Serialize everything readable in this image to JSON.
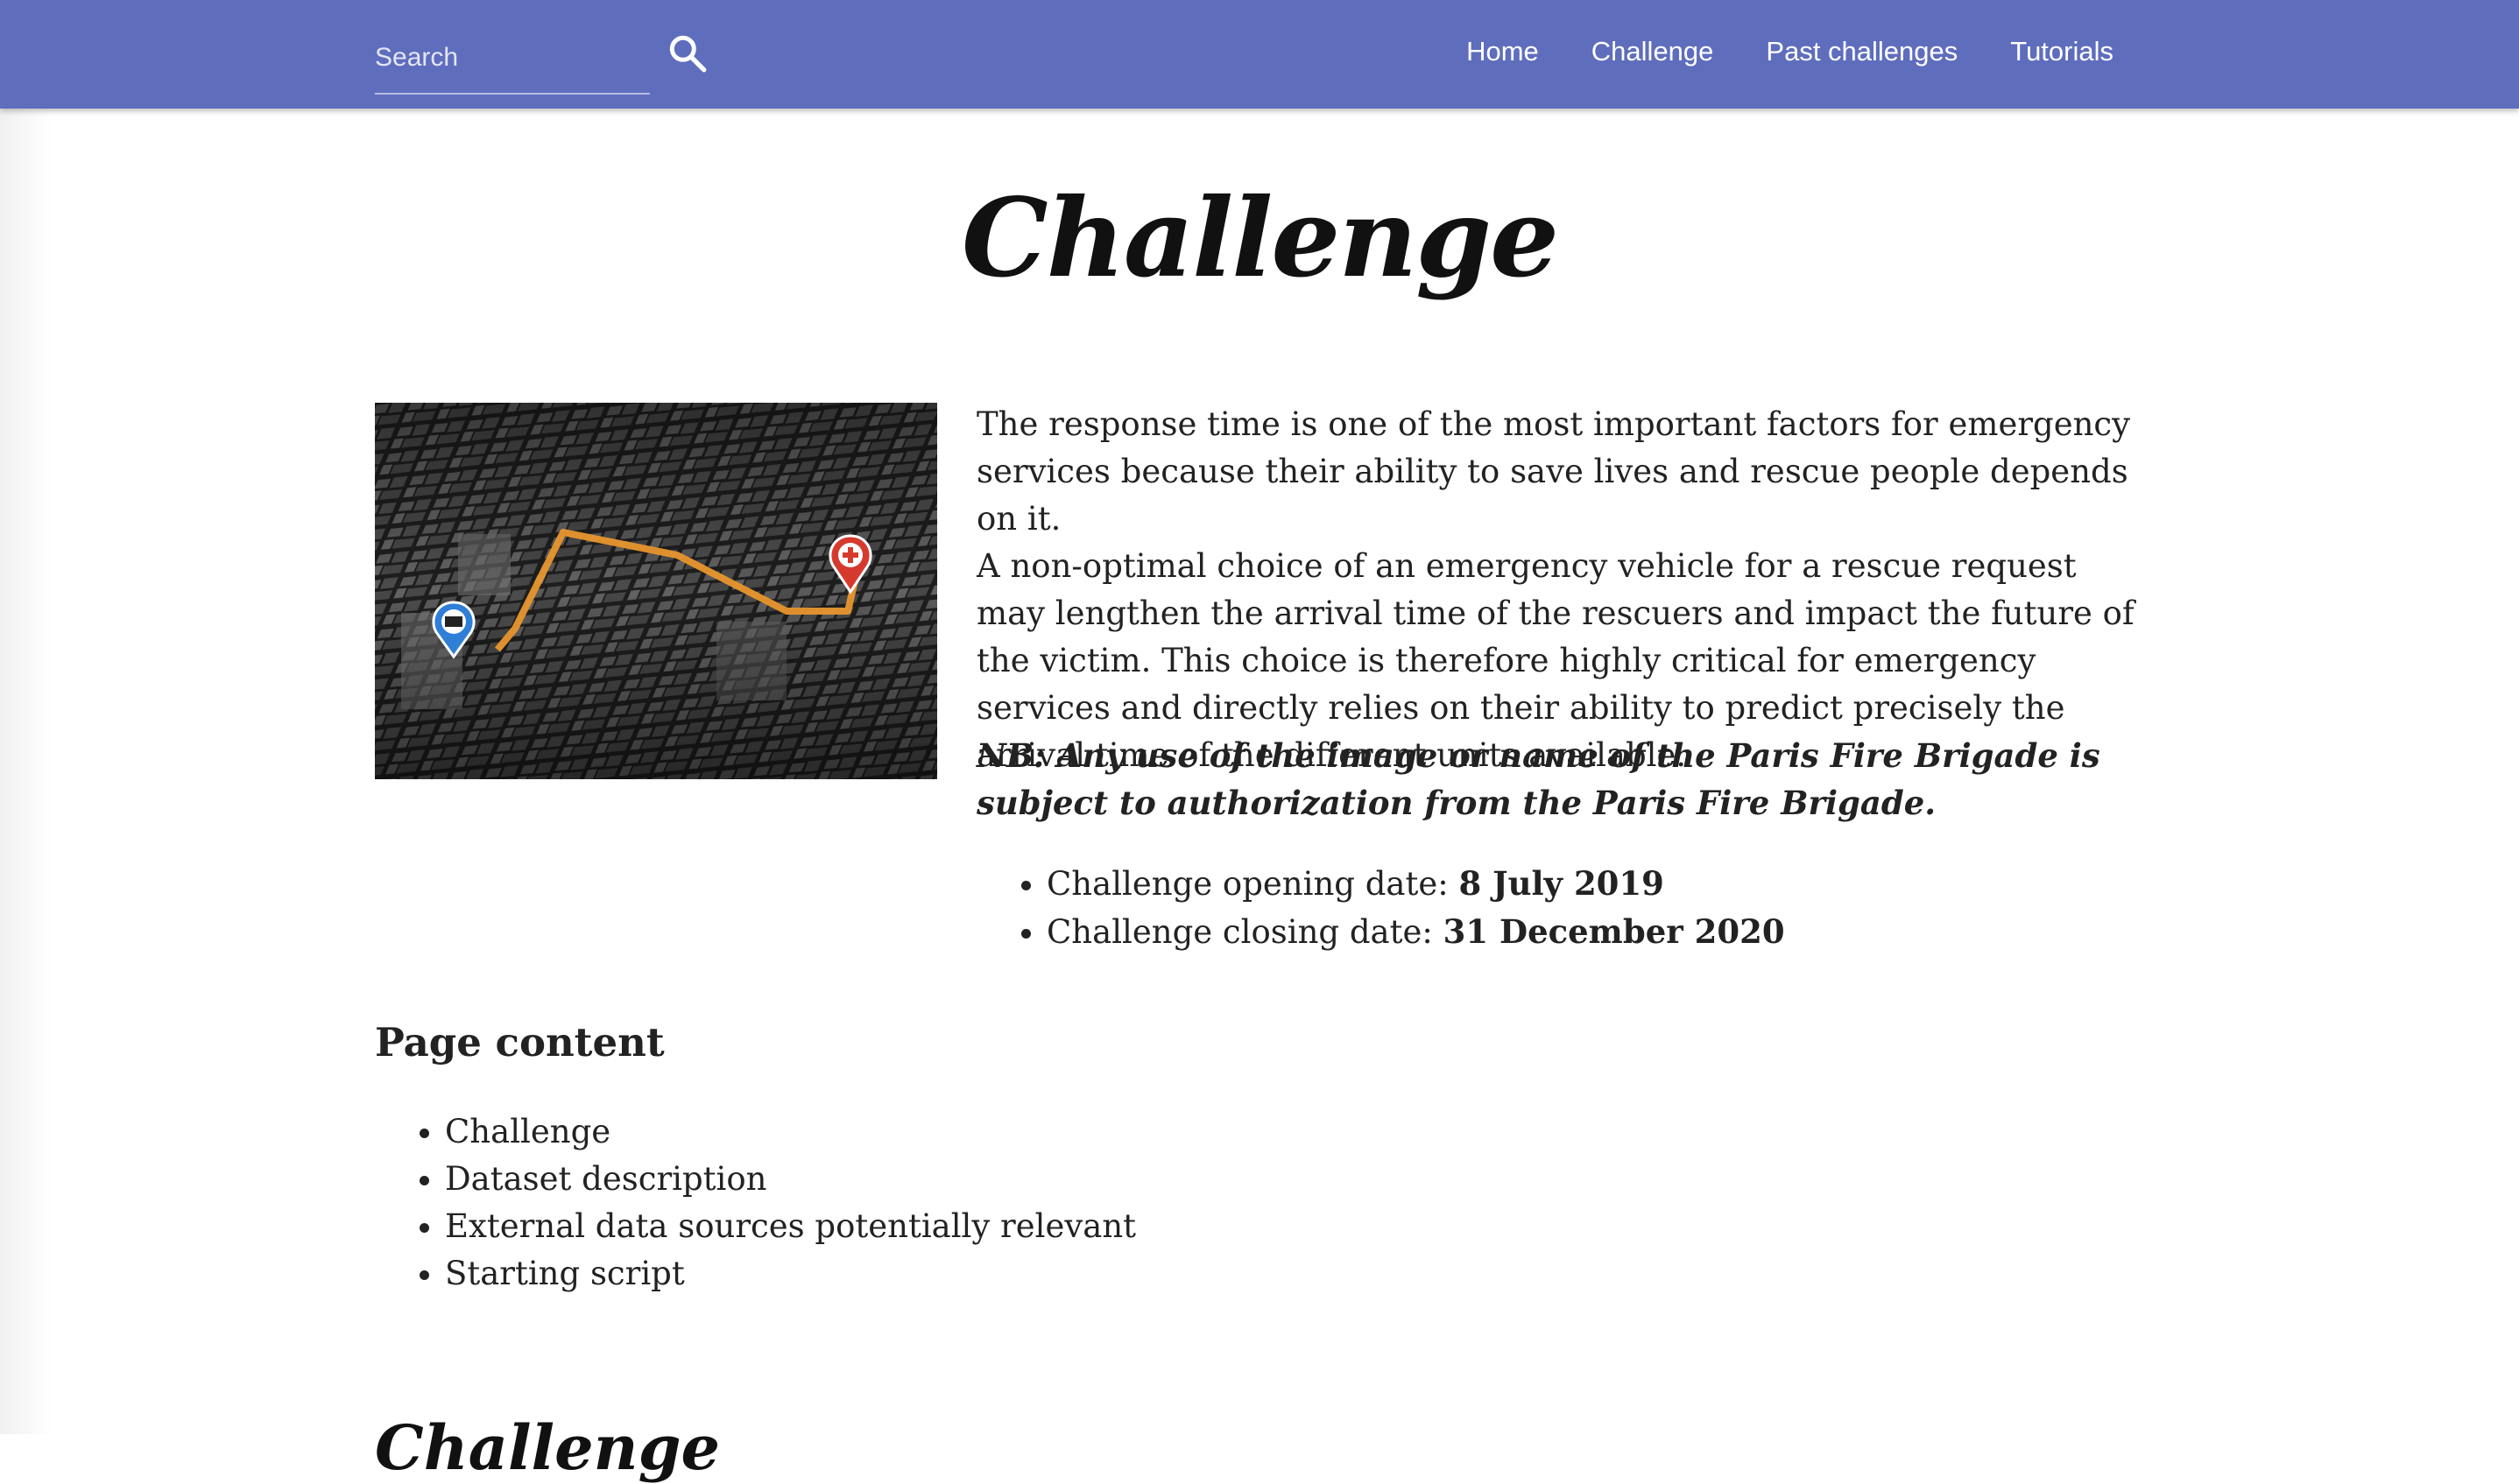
{
  "navbar": {
    "search": {
      "placeholder": "Search",
      "value": ""
    },
    "links": [
      "Home",
      "Challenge",
      "Past challenges",
      "Tutorials"
    ]
  },
  "page": {
    "title": "Challenge"
  },
  "intro": {
    "paragraph1": "The response time is one of the most important factors for emergency services because their ability to save lives and rescue people depends on it.",
    "paragraph2": "A non-optimal choice of an emergency vehicle for a rescue request may lengthen the arrival time of the rescuers and impact the future of the victim. This choice is therefore highly critical for emergency services and directly relies on their ability to predict precisely the arrival time of the different units available.",
    "nb": "NB: Any use of the image or name of the Paris Fire Brigade is subject to authorization from the Paris Fire Brigade."
  },
  "dates": [
    {
      "label": "Challenge opening date: ",
      "value": "8 July 2019"
    },
    {
      "label": "Challenge closing date: ",
      "value": "31 December 2020"
    }
  ],
  "page_content": {
    "heading": "Page content",
    "items": [
      "Challenge",
      "Dataset description",
      "External data sources potentially relevant",
      "Starting script"
    ]
  },
  "next_section": {
    "title": "Challenge"
  },
  "colors": {
    "navbar": "#5f6dbd",
    "route": "#e8962e",
    "start_pin": "#2f7fd6",
    "end_pin": "#d63a2f"
  },
  "icons": {
    "search": "search-icon",
    "start_pin": "ambulance-pin-icon",
    "end_pin": "medical-pin-icon"
  }
}
